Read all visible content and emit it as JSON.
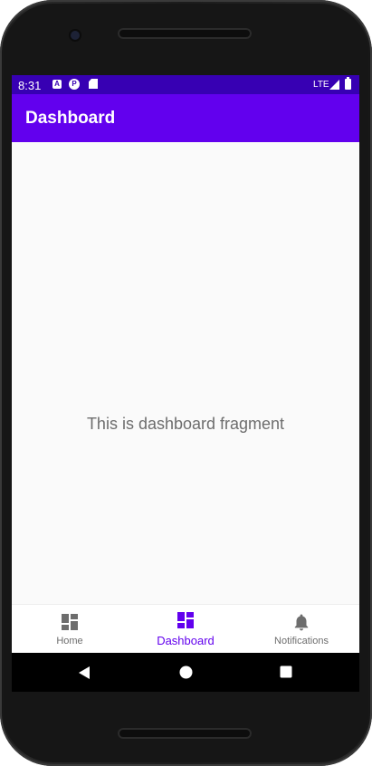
{
  "status_bar": {
    "time": "8:31",
    "network": "LTE",
    "icons": [
      "accessibility-a-icon",
      "p-badge-icon",
      "sd-card-icon",
      "signal-icon",
      "battery-icon"
    ],
    "background": "#3700b3"
  },
  "app_bar": {
    "title": "Dashboard",
    "background": "#6200ee"
  },
  "content": {
    "text": "This is dashboard fragment"
  },
  "bottom_nav": {
    "items": [
      {
        "label": "Home",
        "icon": "dashboard-grid-icon",
        "active": false
      },
      {
        "label": "Dashboard",
        "icon": "dashboard-grid-icon",
        "active": true
      },
      {
        "label": "Notifications",
        "icon": "bell-icon",
        "active": false
      }
    ],
    "active_color": "#6200ee",
    "inactive_color": "#6d6d6d"
  },
  "system_nav": {
    "buttons": [
      "back-icon",
      "home-circle-icon",
      "overview-square-icon"
    ]
  }
}
